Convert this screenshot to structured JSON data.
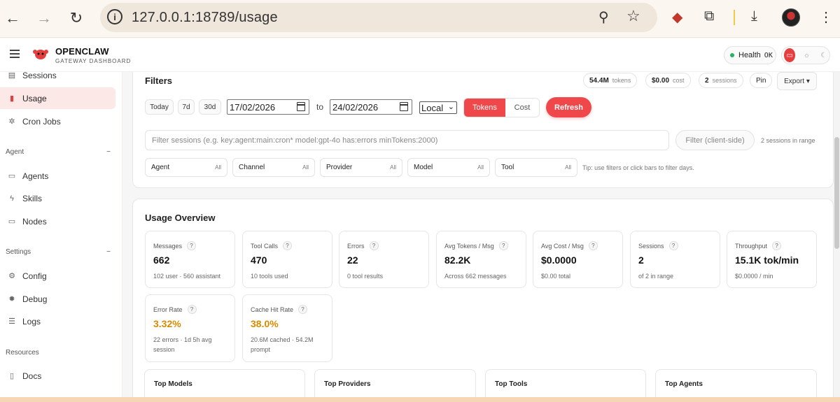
{
  "browser": {
    "url": "127.0.0.1:18789/usage"
  },
  "app": {
    "name": "OPENCLAW",
    "subtitle": "GATEWAY DASHBOARD",
    "health_label": "Health",
    "health_status": "OK",
    "accent": "#f0474a"
  },
  "sidebar": {
    "items_top": [
      {
        "label": "Sessions",
        "icon": "document-icon"
      },
      {
        "label": "Usage",
        "icon": "bar-chart-icon",
        "active": true
      },
      {
        "label": "Cron Jobs",
        "icon": "sparkle-icon"
      }
    ],
    "section_agent": "Agent",
    "items_agent": [
      {
        "label": "Agents",
        "icon": "folder-icon"
      },
      {
        "label": "Skills",
        "icon": "bolt-icon"
      },
      {
        "label": "Nodes",
        "icon": "monitor-icon"
      }
    ],
    "section_settings": "Settings",
    "items_settings": [
      {
        "label": "Config",
        "icon": "gear-icon"
      },
      {
        "label": "Debug",
        "icon": "bug-icon"
      },
      {
        "label": "Logs",
        "icon": "list-icon"
      }
    ],
    "section_resources": "Resources",
    "items_resources": [
      {
        "label": "Docs",
        "icon": "book-icon"
      }
    ]
  },
  "filters": {
    "title": "Filters",
    "tokens_value": "54.4M",
    "tokens_label": "tokens",
    "cost_value": "$0.00",
    "cost_label": "cost",
    "sessions_value": "2",
    "sessions_label": "sessions",
    "pin_label": "Pin",
    "export_label": "Export ▾",
    "range_buttons": [
      "Today",
      "7d",
      "30d"
    ],
    "date_from": "17/02/2026",
    "to_label": "to",
    "date_to": "24/02/2026",
    "timezone": "Local",
    "mode_tokens": "Tokens",
    "mode_cost": "Cost",
    "refresh_label": "Refresh",
    "search_placeholder": "Filter sessions (e.g. key:agent:main:cron* model:gpt-4o has:errors minTokens:2000)",
    "client_side_label": "Filter (client-side)",
    "sessions_in_range": "2 sessions in range",
    "dropdowns": [
      {
        "label": "Agent",
        "value": "All"
      },
      {
        "label": "Channel",
        "value": "All"
      },
      {
        "label": "Provider",
        "value": "All"
      },
      {
        "label": "Model",
        "value": "All"
      },
      {
        "label": "Tool",
        "value": "All"
      }
    ],
    "tip": "Tip: use filters or click bars to filter days."
  },
  "overview": {
    "title": "Usage Overview",
    "stats": [
      {
        "label": "Messages",
        "value": "662",
        "sub": "102 user · 560 assistant"
      },
      {
        "label": "Tool Calls",
        "value": "470",
        "sub": "10 tools used"
      },
      {
        "label": "Errors",
        "value": "22",
        "sub": "0 tool results"
      },
      {
        "label": "Avg Tokens / Msg",
        "value": "82.2K",
        "sub": "Across 662 messages"
      },
      {
        "label": "Avg Cost / Msg",
        "value": "$0.0000",
        "sub": "$0.00 total"
      },
      {
        "label": "Sessions",
        "value": "2",
        "sub": "of 2 in range"
      },
      {
        "label": "Throughput",
        "value": "15.1K tok/min",
        "sub": "$0.0000 / min"
      },
      {
        "label": "Error Rate",
        "value": "3.32%",
        "sub": "22 errors · 1d 5h avg session"
      },
      {
        "label": "Cache Hit Rate",
        "value": "38.0%",
        "sub": "20.6M cached · 54.2M prompt"
      }
    ],
    "help_glyph": "?",
    "warn_color": "#d88b00",
    "top_cards": [
      "Top Models",
      "Top Providers",
      "Top Tools",
      "Top Agents"
    ]
  }
}
